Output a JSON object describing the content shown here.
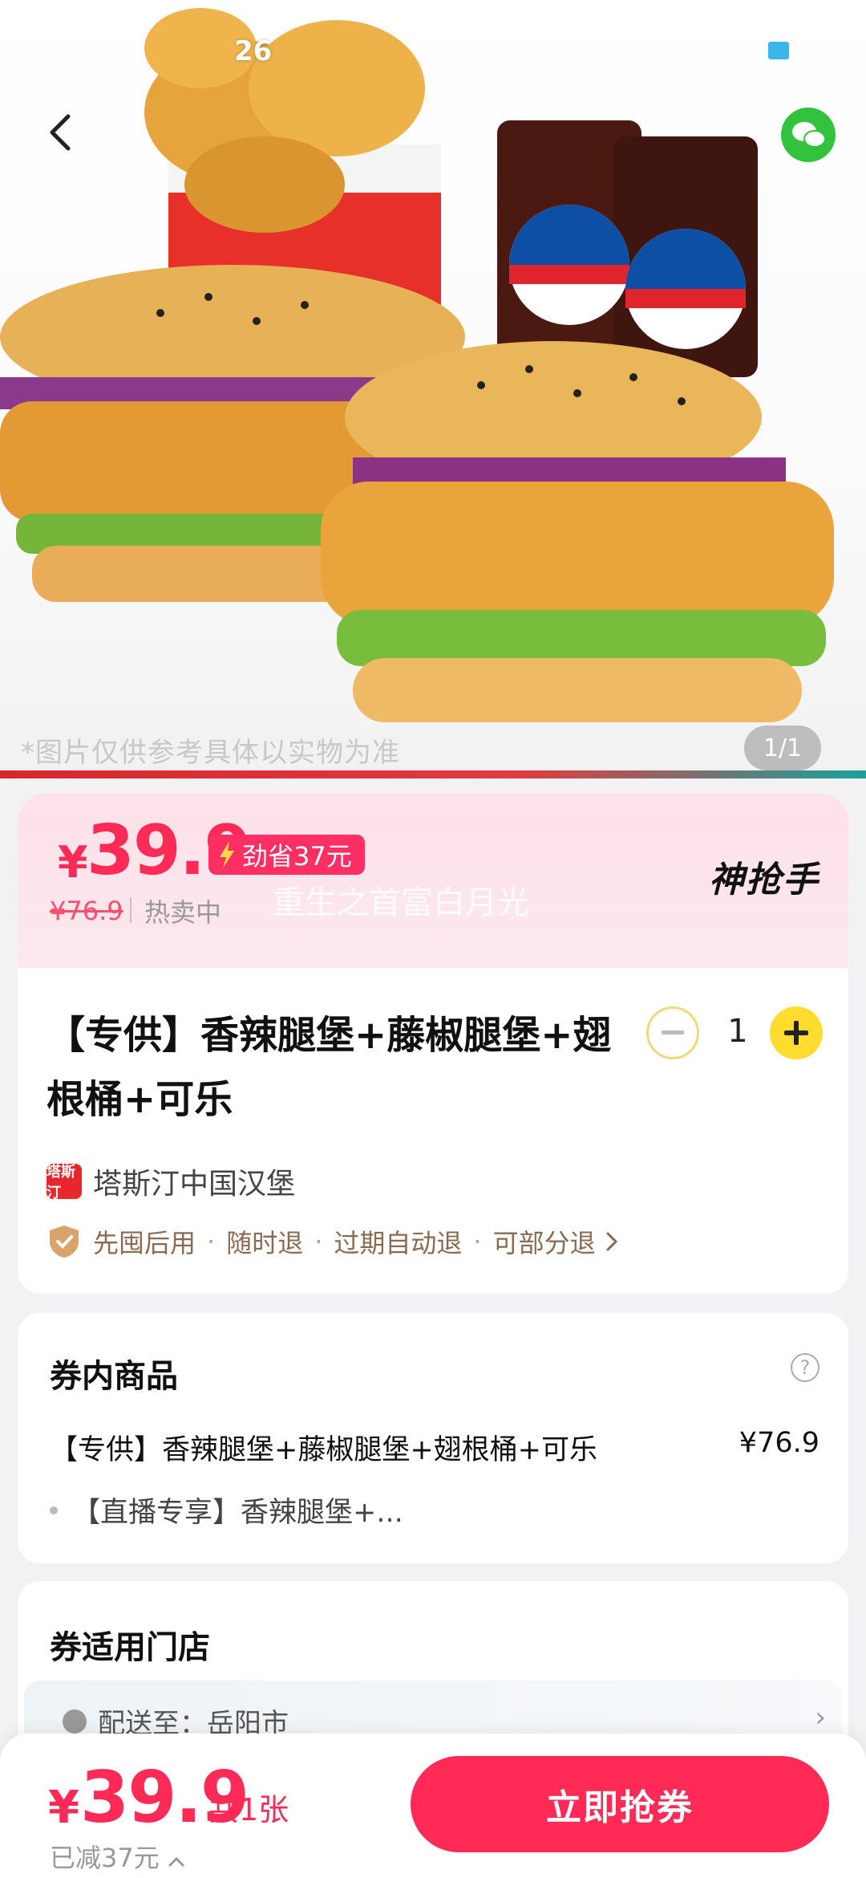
{
  "status": {
    "time": "26"
  },
  "hero": {
    "note": "*图片仅供参考具体以实物为准",
    "counter": "1/1"
  },
  "price": {
    "yen": "¥",
    "value": "39.9",
    "save_badge": "劲省37元",
    "original": "¥76.9",
    "hot": "热卖中",
    "overlay": "重生之首富白月光",
    "brand": "神抢手"
  },
  "product": {
    "title": "【专供】香辣腿堡+藤椒腿堡+翅根桶+可乐",
    "quantity": "1",
    "store_name": "塔斯汀中国汉堡",
    "store_logo": "塔斯汀",
    "guarantees": [
      "先囤后用",
      "随时退",
      "过期自动退",
      "可部分退"
    ]
  },
  "voucher_items": {
    "title": "券内商品",
    "item_name": "【专供】香辣腿堡+藤椒腿堡+翅根桶+可乐",
    "item_price": "¥76.9",
    "sub_item": "【直播专享】香辣腿堡+..."
  },
  "stores": {
    "title": "券适用门店",
    "deliver": "配送至：岳阳市"
  },
  "bottom": {
    "yen": "¥",
    "price": "39.9",
    "count": "共1张",
    "saved": "已减37元",
    "button": "立即抢券"
  },
  "colors": {
    "accent": "#ff2a55",
    "yellow": "#ffdc2e",
    "wechat": "#33c23c"
  }
}
